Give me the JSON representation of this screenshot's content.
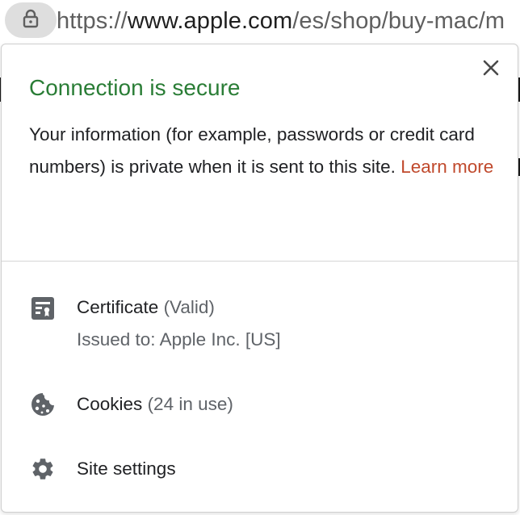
{
  "omnibox": {
    "lock_icon": "lock-icon",
    "url_scheme": "https://",
    "url_host": "www.apple.com",
    "url_path": "/es/shop/buy-mac/m"
  },
  "popup": {
    "close_icon": "close-icon",
    "title": "Connection is secure",
    "description": "Your information (for example, passwords or credit card numbers) is private when it is sent to this site.",
    "learn_more": "Learn more",
    "colors": {
      "title": "#2a7d36",
      "link": "#c0492c"
    },
    "certificate": {
      "icon": "certificate-icon",
      "label": "Certificate",
      "status": "(Valid)",
      "issued_to": "Issued to: Apple Inc. [US]"
    },
    "cookies": {
      "icon": "cookie-icon",
      "label": "Cookies",
      "status": "(24 in use)"
    },
    "site_settings": {
      "icon": "gear-icon",
      "label": "Site settings"
    }
  }
}
